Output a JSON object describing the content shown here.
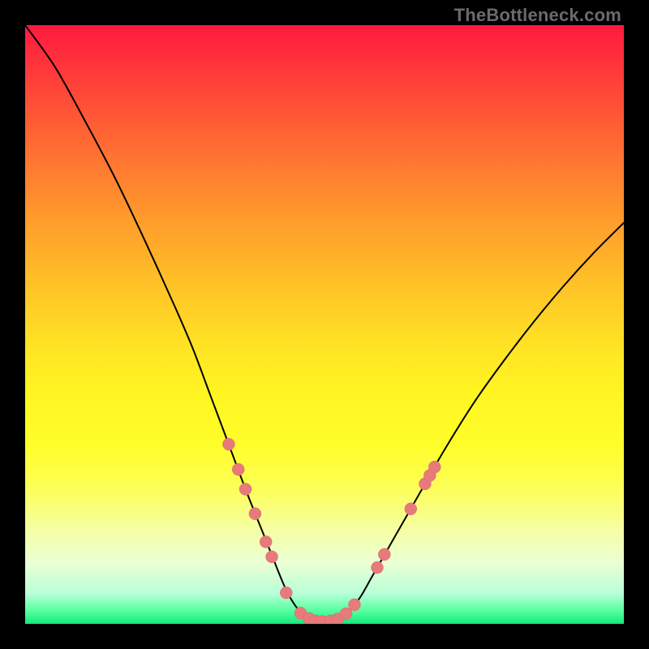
{
  "branding": "TheBottleneck.com",
  "colors": {
    "frame_bg": "#000000",
    "curve_stroke": "#000000",
    "marker_fill": "#e77a7a",
    "marker_stroke": "#d86a6a"
  },
  "chart_data": {
    "type": "line",
    "title": "",
    "xlabel": "",
    "ylabel": "",
    "xlim": [
      0,
      100
    ],
    "ylim": [
      0,
      100
    ],
    "grid": false,
    "legend": false,
    "series": [
      {
        "name": "curve",
        "x": [
          0,
          5,
          10,
          15,
          20,
          25,
          28,
          31,
          34,
          37,
          40,
          43,
          44.5,
          46,
          48,
          50,
          52,
          54,
          56,
          58,
          62,
          66,
          70,
          75,
          80,
          85,
          90,
          95,
          100
        ],
        "y": [
          100,
          93,
          84,
          74.5,
          64,
          53,
          46,
          38,
          30,
          22,
          14.5,
          7,
          4,
          2,
          0.7,
          0.4,
          0.7,
          2,
          4.5,
          8,
          15,
          22,
          29,
          37,
          44,
          50.5,
          56.5,
          62,
          67
        ]
      }
    ],
    "markers": [
      {
        "x": 34.0,
        "y": 30.0
      },
      {
        "x": 35.6,
        "y": 25.8
      },
      {
        "x": 36.8,
        "y": 22.5
      },
      {
        "x": 38.4,
        "y": 18.4
      },
      {
        "x": 40.2,
        "y": 13.7
      },
      {
        "x": 41.2,
        "y": 11.2
      },
      {
        "x": 43.6,
        "y": 5.2
      },
      {
        "x": 46.0,
        "y": 1.8
      },
      {
        "x": 47.4,
        "y": 0.9
      },
      {
        "x": 48.4,
        "y": 0.5
      },
      {
        "x": 49.6,
        "y": 0.4
      },
      {
        "x": 51.0,
        "y": 0.5
      },
      {
        "x": 52.2,
        "y": 0.8
      },
      {
        "x": 53.6,
        "y": 1.7
      },
      {
        "x": 55.0,
        "y": 3.2
      },
      {
        "x": 58.8,
        "y": 9.4
      },
      {
        "x": 60.0,
        "y": 11.6
      },
      {
        "x": 64.4,
        "y": 19.2
      },
      {
        "x": 66.8,
        "y": 23.4
      },
      {
        "x": 67.6,
        "y": 24.8
      },
      {
        "x": 68.4,
        "y": 26.2
      }
    ]
  }
}
